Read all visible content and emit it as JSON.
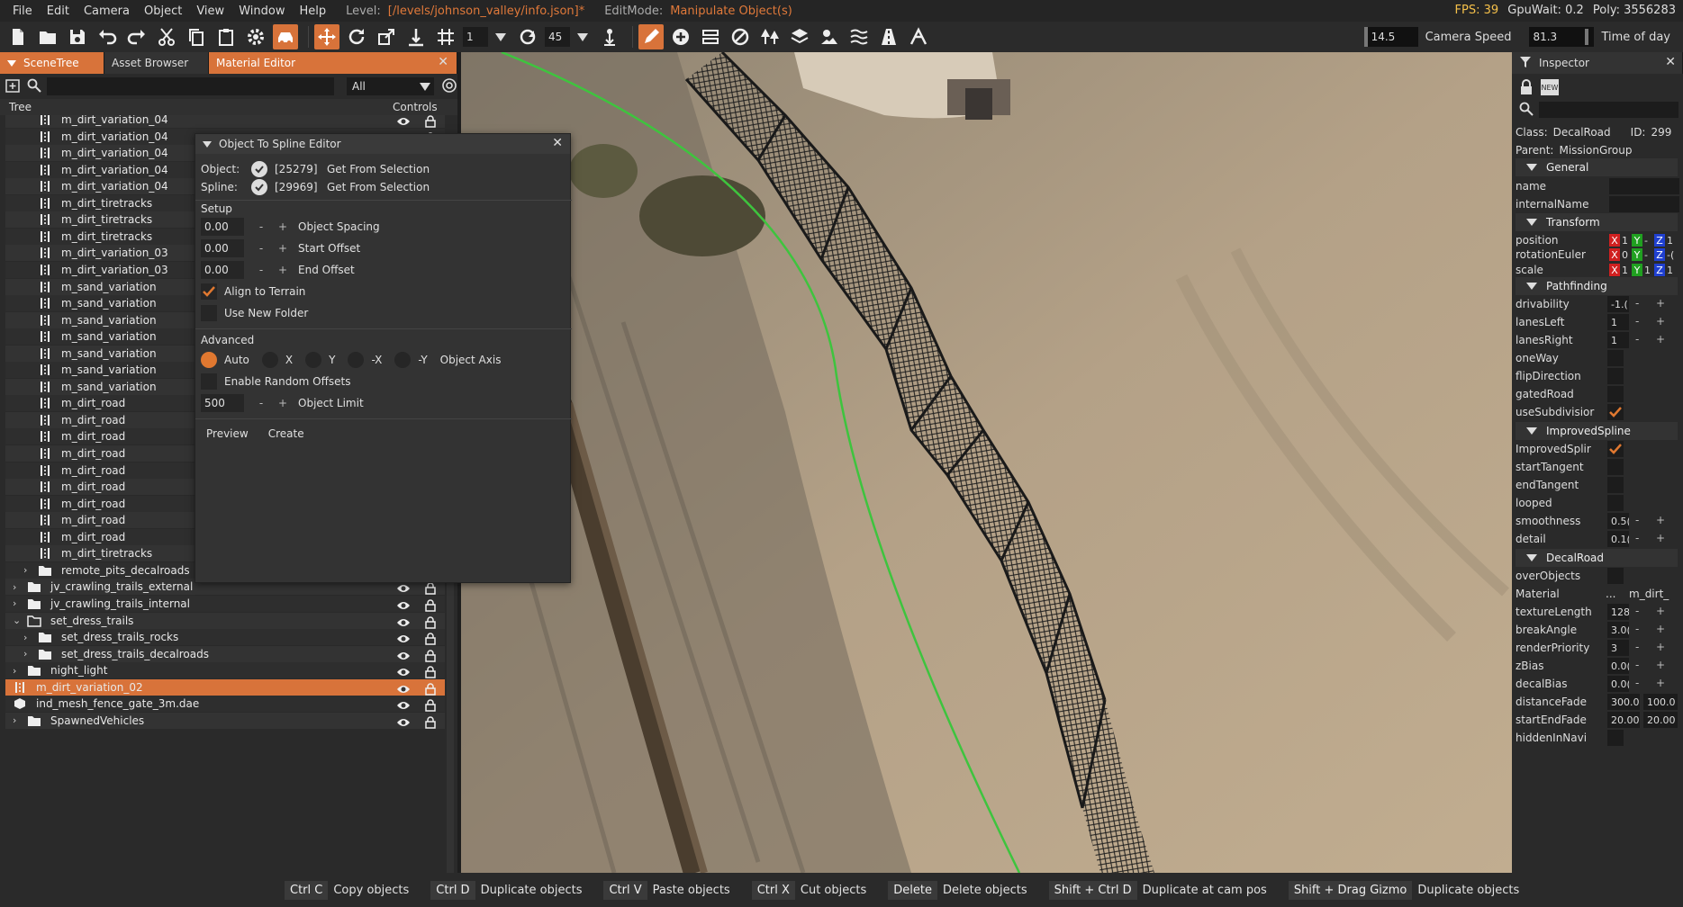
{
  "menu": {
    "items": [
      "File",
      "Edit",
      "Camera",
      "Object",
      "View",
      "Window",
      "Help"
    ],
    "level_label": "Level:",
    "level_value": "[/levels/johnson_valley/info.json]*",
    "editmode_label": "EditMode:",
    "editmode_value": "Manipulate Object(s)",
    "fps": "FPS: 39",
    "gpuwait": "GpuWait: 0.2",
    "poly": "Poly: 3556283"
  },
  "toolbar": {
    "grid_value": "1",
    "angle_value": "45",
    "camera_speed_value": "14.5",
    "camera_speed_label": "Camera Speed",
    "time_value": "81.3",
    "time_label": "Time of day"
  },
  "left_panel": {
    "tabs": [
      "SceneTree",
      "Asset Browser",
      "Material Editor"
    ],
    "filter_value": "All",
    "col_tree": "Tree",
    "col_controls": "Controls",
    "rows": [
      {
        "label": "m_dirt_variation_04",
        "type": "road",
        "indent": 1
      },
      {
        "label": "m_dirt_variation_04",
        "type": "road",
        "indent": 1
      },
      {
        "label": "m_dirt_variation_04",
        "type": "road",
        "indent": 1
      },
      {
        "label": "m_dirt_variation_04",
        "type": "road",
        "indent": 1
      },
      {
        "label": "m_dirt_variation_04",
        "type": "road",
        "indent": 1
      },
      {
        "label": "m_dirt_tiretracks",
        "type": "road",
        "indent": 1
      },
      {
        "label": "m_dirt_tiretracks",
        "type": "road",
        "indent": 1
      },
      {
        "label": "m_dirt_tiretracks",
        "type": "road",
        "indent": 1
      },
      {
        "label": "m_dirt_variation_03",
        "type": "road",
        "indent": 1
      },
      {
        "label": "m_dirt_variation_03",
        "type": "road",
        "indent": 1
      },
      {
        "label": "m_sand_variation",
        "type": "road",
        "indent": 1
      },
      {
        "label": "m_sand_variation",
        "type": "road",
        "indent": 1
      },
      {
        "label": "m_sand_variation",
        "type": "road",
        "indent": 1
      },
      {
        "label": "m_sand_variation",
        "type": "road",
        "indent": 1
      },
      {
        "label": "m_sand_variation",
        "type": "road",
        "indent": 1
      },
      {
        "label": "m_sand_variation",
        "type": "road",
        "indent": 1
      },
      {
        "label": "m_sand_variation",
        "type": "road",
        "indent": 1
      },
      {
        "label": "m_dirt_road",
        "type": "road",
        "indent": 1
      },
      {
        "label": "m_dirt_road",
        "type": "road",
        "indent": 1
      },
      {
        "label": "m_dirt_road",
        "type": "road",
        "indent": 1
      },
      {
        "label": "m_dirt_road",
        "type": "road",
        "indent": 1
      },
      {
        "label": "m_dirt_road",
        "type": "road",
        "indent": 1
      },
      {
        "label": "m_dirt_road",
        "type": "road",
        "indent": 1
      },
      {
        "label": "m_dirt_road",
        "type": "road",
        "indent": 1
      },
      {
        "label": "m_dirt_road",
        "type": "road",
        "indent": 1
      },
      {
        "label": "m_dirt_road",
        "type": "road",
        "indent": 1
      },
      {
        "label": "m_dirt_tiretracks",
        "type": "road",
        "indent": 1
      },
      {
        "label": "remote_pits_decalroads",
        "type": "folder",
        "indent": 1,
        "chev": "›"
      },
      {
        "label": "jv_crawling_trails_external",
        "type": "folder",
        "indent": 0,
        "chev": "›"
      },
      {
        "label": "jv_crawling_trails_internal",
        "type": "folder",
        "indent": 0,
        "chev": "›"
      },
      {
        "label": "set_dress_trails",
        "type": "folder-open",
        "indent": 0,
        "chev": "⌄"
      },
      {
        "label": "set_dress_trails_rocks",
        "type": "folder",
        "indent": 1,
        "chev": "›"
      },
      {
        "label": "set_dress_trails_decalroads",
        "type": "folder",
        "indent": 1,
        "chev": "›"
      },
      {
        "label": "night_light",
        "type": "folder",
        "indent": 0,
        "chev": "›"
      },
      {
        "label": "m_dirt_variation_02",
        "type": "road",
        "indent": -1,
        "selected": true
      },
      {
        "label": "ind_mesh_fence_gate_3m.dae",
        "type": "mesh",
        "indent": -1
      },
      {
        "label": "SpawnedVehicles",
        "type": "folder",
        "indent": 0,
        "chev": "›"
      }
    ]
  },
  "dialog": {
    "title": "Object To Spline Editor",
    "object_label": "Object:",
    "object_id": "[25279]",
    "object_btn": "Get From Selection",
    "spline_label": "Spline:",
    "spline_id": "[29969]",
    "spline_btn": "Get From Selection",
    "setup_label": "Setup",
    "object_spacing_value": "0.00",
    "object_spacing_label": "Object Spacing",
    "start_offset_value": "0.00",
    "start_offset_label": "Start Offset",
    "end_offset_value": "0.00",
    "end_offset_label": "End Offset",
    "align_terrain_label": "Align to Terrain",
    "use_new_folder_label": "Use New Folder",
    "advanced_label": "Advanced",
    "axis_auto": "Auto",
    "axis_x": "X",
    "axis_y": "Y",
    "axis_nx": "-X",
    "axis_ny": "-Y",
    "object_axis_label": "Object Axis",
    "random_offsets_label": "Enable Random Offsets",
    "object_limit_value": "500",
    "object_limit_label": "Object Limit",
    "preview_btn": "Preview",
    "create_btn": "Create",
    "minus": "-",
    "plus": "+"
  },
  "inspector": {
    "title": "Inspector",
    "class_label": "Class:",
    "class_value": "DecalRoad",
    "id_label": "ID:",
    "id_value": "299",
    "parent_label": "Parent:",
    "parent_value": "MissionGroup",
    "sec_general": "General",
    "name": "name",
    "internal_name": "internalName",
    "sec_transform": "Transform",
    "position": "position",
    "rotation": "rotationEuler",
    "scale": "scale",
    "pos_x": "1",
    "pos_y": "-",
    "pos_z": "1",
    "rot_x": "0",
    "rot_y": "-",
    "rot_z": "-(",
    "scl_x": "1",
    "scl_y": "1",
    "scl_z": "1",
    "sec_pathfinding": "Pathfinding",
    "drivability": "drivability",
    "drivability_value": "-1.(",
    "lanes_left": "lanesLeft",
    "lanes_left_value": "1",
    "lanes_right": "lanesRight",
    "lanes_right_value": "1",
    "one_way": "oneWay",
    "flip_direction": "flipDirection",
    "gated_road": "gatedRoad",
    "use_subdivision": "useSubdivisior",
    "sec_improved": "ImprovedSpline",
    "improved_spline": "ImprovedSplir",
    "start_tangent": "startTangent",
    "end_tangent": "endTangent",
    "looped": "looped",
    "smoothness": "smoothness",
    "smoothness_value": "0.5(",
    "detail": "detail",
    "detail_value": "0.1(",
    "sec_decalroad": "DecalRoad",
    "over_objects": "overObjects",
    "material": "Material",
    "material_dots": "...",
    "material_value": "m_dirt_",
    "texture_length": "textureLength",
    "texture_length_value": "128",
    "break_angle": "breakAngle",
    "break_angle_value": "3.0(",
    "render_priority": "renderPriority",
    "render_priority_value": "3",
    "zbias": "zBias",
    "zbias_value": "0.0(",
    "decal_bias": "decalBias",
    "decal_bias_value": "0.0(",
    "distance_fade": "distanceFade",
    "distance_fade_a": "300.0",
    "distance_fade_b": "100.0",
    "start_end_fade": "startEndFade",
    "start_end_fade_a": "20.00",
    "start_end_fade_b": "20.00",
    "hidden_in_navi": "hiddenInNavi",
    "minus": "-",
    "plus": "+"
  },
  "statusbar": [
    {
      "key": "Ctrl C",
      "action": "Copy objects"
    },
    {
      "key": "Ctrl D",
      "action": "Duplicate objects"
    },
    {
      "key": "Ctrl V",
      "action": "Paste objects"
    },
    {
      "key": "Ctrl X",
      "action": "Cut objects"
    },
    {
      "key": "Delete",
      "action": "Delete objects"
    },
    {
      "key": "Shift + Ctrl D",
      "action": "Duplicate at cam pos"
    },
    {
      "key": "Shift + Drag Gizmo",
      "action": "Duplicate objects"
    }
  ],
  "colors": {
    "accent": "#d8733a",
    "spline": "#3ec43e",
    "bg": "#2a2a2a"
  }
}
